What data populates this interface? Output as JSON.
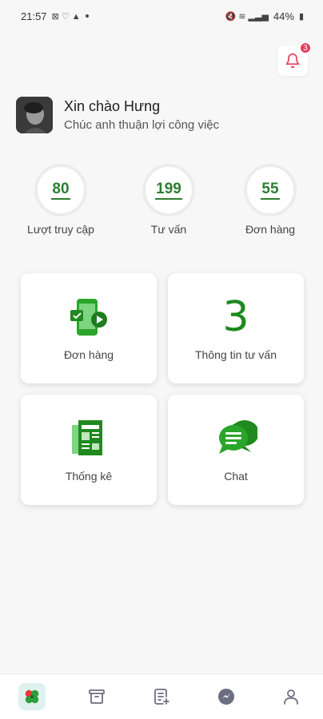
{
  "status_bar": {
    "time": "21:57",
    "battery": "44%"
  },
  "notifications": {
    "count": "3"
  },
  "profile": {
    "greeting": "Xin chào Hưng",
    "subtitle": "Chúc anh thuận lợi công việc"
  },
  "stats": [
    {
      "value": "80",
      "label": "Lượt truy cập"
    },
    {
      "value": "199",
      "label": "Tư vấn"
    },
    {
      "value": "55",
      "label": "Đơn hàng"
    }
  ],
  "cards": {
    "orders": {
      "label": "Đơn hàng",
      "icon": "mobile-order-icon"
    },
    "consult": {
      "number": "3",
      "label": "Thông tin tư vấn"
    },
    "stats": {
      "label": "Thống kê",
      "icon": "report-icon"
    },
    "chat": {
      "label": "Chat",
      "icon": "chat-bubbles-icon"
    }
  },
  "bottom_nav": [
    {
      "icon": "clover-icon",
      "active": true
    },
    {
      "icon": "archive-box-icon",
      "active": false
    },
    {
      "icon": "edit-list-icon",
      "active": false
    },
    {
      "icon": "messenger-icon",
      "active": false
    },
    {
      "icon": "user-icon",
      "active": false
    }
  ],
  "colors": {
    "accent": "#2e7d32",
    "badge": "#e93b5a",
    "nav_active_bg": "#dff1ef"
  }
}
